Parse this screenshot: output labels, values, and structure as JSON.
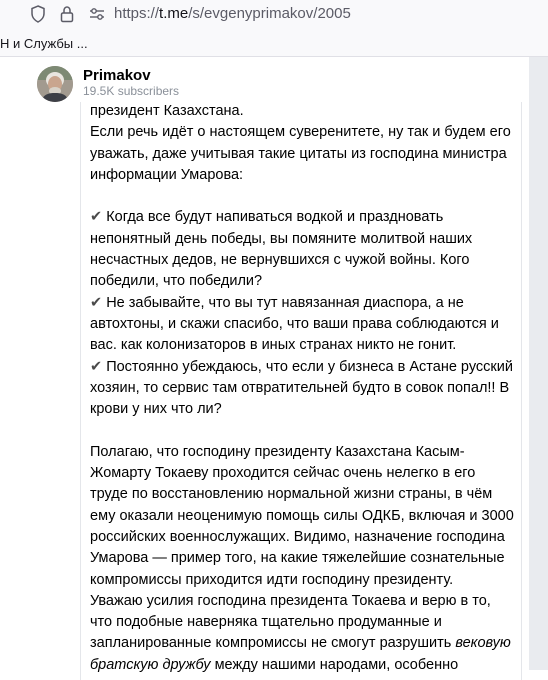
{
  "browser": {
    "url_prefix": "https://",
    "url_host": "t.me",
    "url_path": "/s/evgenyprimakov/2005",
    "bookmark": "Н и Службы ..."
  },
  "channel": {
    "name": "Primakov",
    "subscribers": "19.5K subscribers"
  },
  "post": {
    "l1": "президент Казахстана.",
    "l2": "Если речь идёт о настоящем суверенитете, ну так и будем его уважать, даже учитывая такие цитаты из господина министра информации Умарова:",
    "q1": "Когда все будут напиваться водкой и праздновать непонятный день победы, вы помяните молитвой наших несчастных дедов, не вернувшихся с чужой войны. Кого победили, что победили?",
    "q2": "Не забывайте, что вы тут навязанная диаспора, а не автохтоны, и скажи спасибо, что ваши права соблюдаются и вас. как колонизаторов в иных странах никто не гонит.",
    "q3": "Постоянно убеждаюсь, что если у бизнеса в Астане русский хозяин, то сервис там отвратительней будто в совок попал!! В крови у них что ли?",
    "p1": "Полагаю, что господину президенту Казахстана Касым-Жомарту Токаеву проходится сейчас очень нелегко в его труде по восстановлению нормальной жизни страны, в чём ему оказали неоценимую помощь силы ОДКБ, включая и 3000 российских военнослужащих. Видимо, назначение господина Умарова — пример того, на какие тяжелейшие сознательные компромиссы приходится идти господину президенту.",
    "p2_start": "Уважаю усилия господина президента Токаева и верю в то, что подобные наверняка тщательно продуманные и запланированные компромиссы не смогут разрушить",
    "p2_italic": "вековую братскую дружбу",
    "p2_end": " между нашими народами, особенно",
    "check": "✔"
  }
}
